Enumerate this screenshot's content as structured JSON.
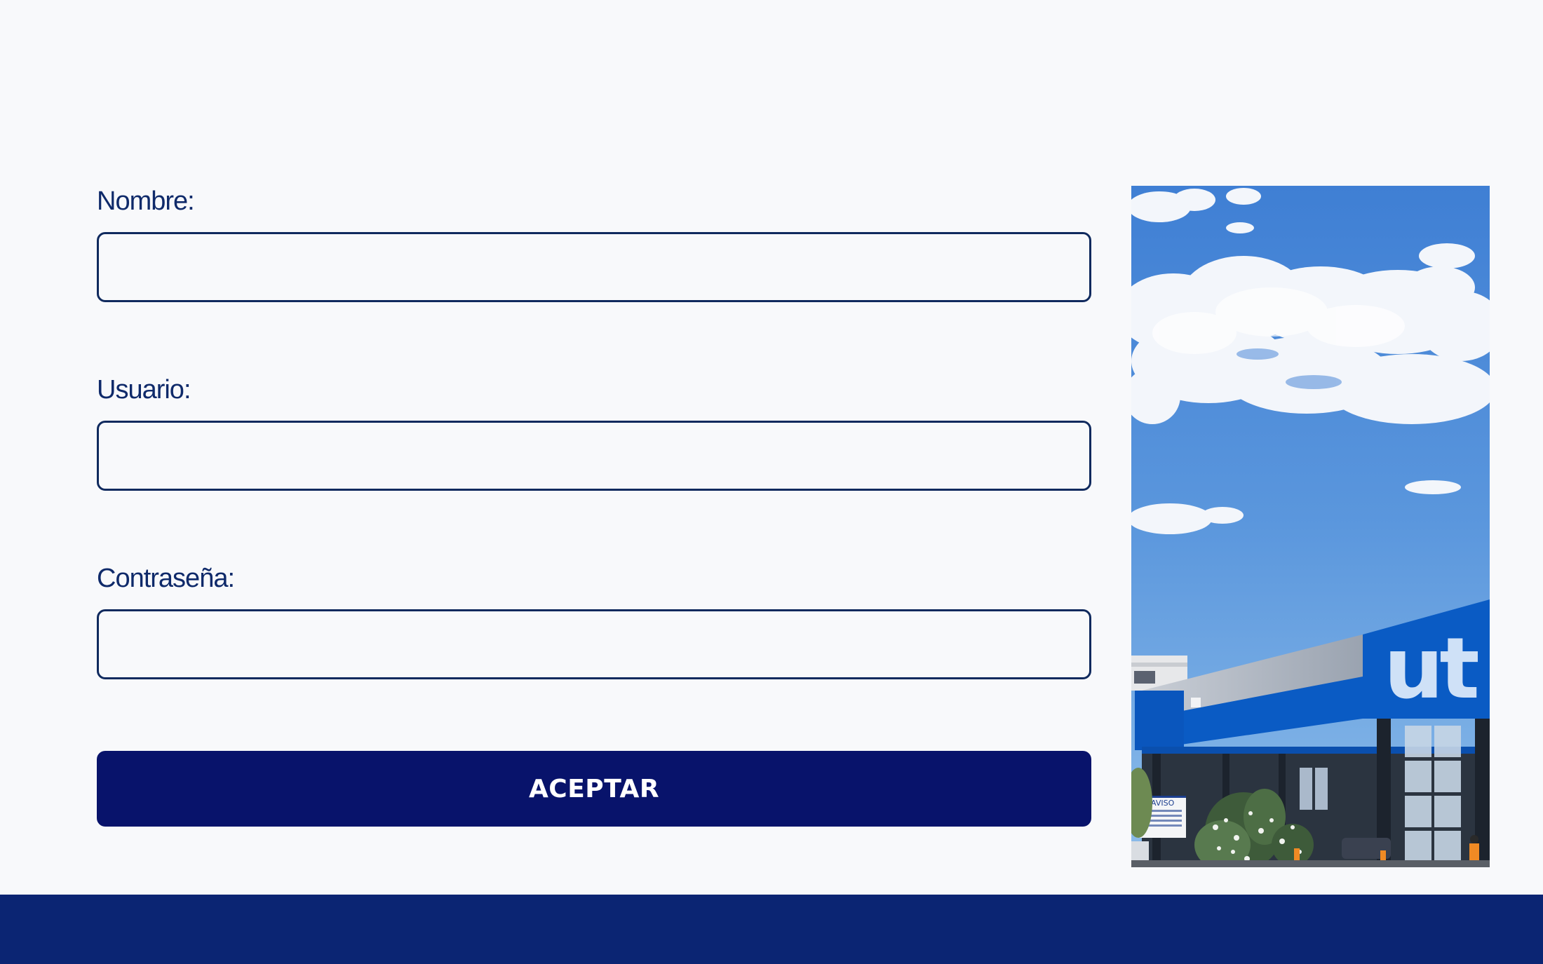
{
  "form": {
    "fields": [
      {
        "label": "Nombre:",
        "value": "",
        "placeholder": ""
      },
      {
        "label": "Usuario:",
        "value": "",
        "placeholder": ""
      },
      {
        "label": "Contraseña:",
        "value": "",
        "placeholder": ""
      }
    ],
    "submit_label": "ACEPTAR"
  },
  "photo": {
    "logo_text": "ut",
    "sign_title": "AVISO"
  },
  "colors": {
    "background": "#f8f9fb",
    "label_text": "#0f2a6a",
    "input_border": "#102a5e",
    "button": "#08136b",
    "footer": "#0b2573",
    "brand_blue": "#0a5bc4"
  }
}
